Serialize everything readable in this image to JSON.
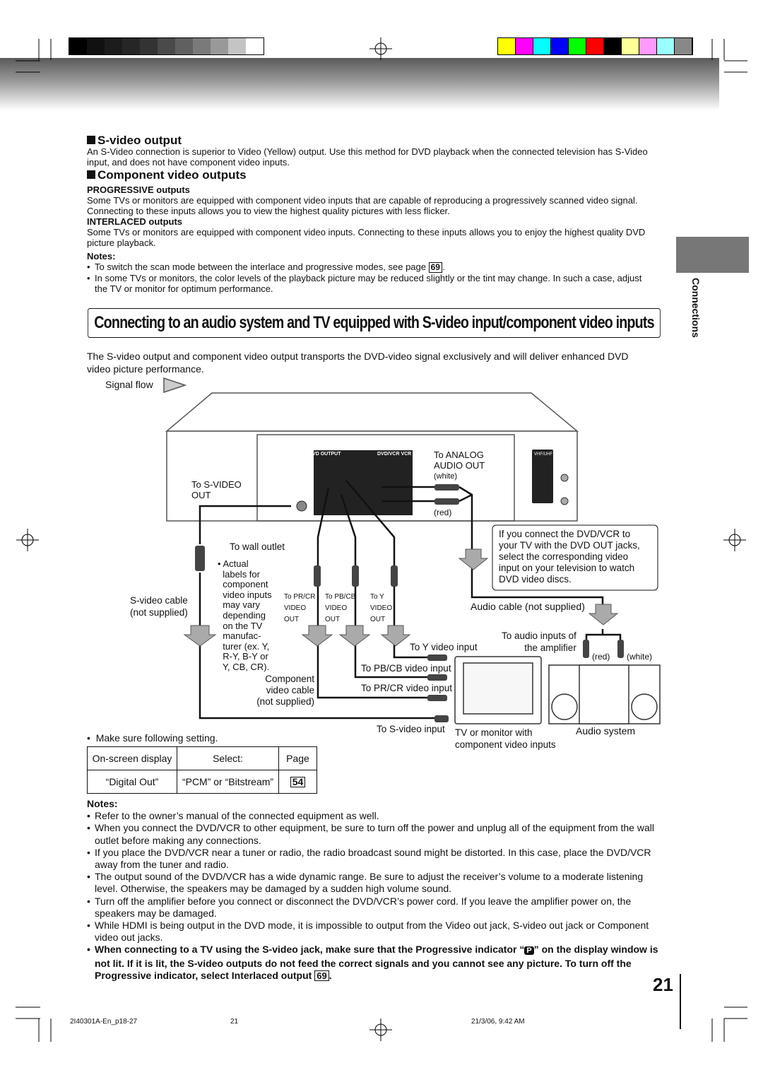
{
  "colors": {
    "gray_bars": [
      "#000",
      "#111",
      "#1c1c1c",
      "#262626",
      "#333",
      "#4a4a4a",
      "#606060",
      "#7a7a7a",
      "#999",
      "#c4c4c4",
      "#fff"
    ],
    "color_bars": [
      "#ffff00",
      "#ff00ff",
      "#00ffff",
      "#0000ff",
      "#00ff00",
      "#ff0000",
      "#000000",
      "#ffff99",
      "#ff99ff",
      "#99ffff",
      "#888888"
    ]
  },
  "side_tab": "Connections",
  "svideo": {
    "title": "S-video output",
    "text": "An S-Video connection is superior to Video (Yellow) output. Use this method for DVD playback when the connected television has S-Video input, and does not have component video inputs."
  },
  "component": {
    "title": "Component video outputs",
    "prog_title": "PROGRESSIVE outputs",
    "prog_text": "Some TVs or monitors are equipped with component video inputs that are capable of reproducing a progressively scanned video signal. Connecting to these inputs allows you to view the highest quality pictures with less flicker.",
    "inter_title": "INTERLACED outputs",
    "inter_text": "Some TVs or monitors are equipped with component video inputs. Connecting to these inputs allows you to enjoy the highest quality DVD picture playback."
  },
  "notes1": {
    "title": "Notes:",
    "items": [
      "To switch the scan mode between the interlace and progressive modes, see page",
      "In some TVs or monitors, the color levels of the playback picture may be reduced slightly or the tint may change. In such a case, adjust the TV or monitor for optimum performance."
    ],
    "page_ref": "69"
  },
  "banner": "Connecting to an audio system and TV equipped with S-video input/component video inputs",
  "intro": "The S-video output and component video output transports the DVD-video signal exclusively and will deliver enhanced DVD video picture performance.",
  "diagram": {
    "signal_flow": "Signal flow",
    "to_svideo_out": "To S-VIDEO\nOUT",
    "to_analog": "To ANALOG\nAUDIO OUT",
    "white": "(white)",
    "red": "(red)",
    "wall": "To wall outlet",
    "actual": "• Actual\n  labels for\n  component\n  video inputs\n  may vary\n  depending\n  on the TV\n  manufac-\n  turer (ex. Y,\n  R-Y, B-Y or\n  Y, CB, CR).",
    "pr_out": "To PR/CR\nVIDEO\nOUT",
    "pb_out": "To PB/CB\nVIDEO\nOUT",
    "y_out": "To Y\nVIDEO\nOUT",
    "svideo_cable": "S-video cable\n(not supplied)",
    "comp_cable": "Component\nvideo cable\n(not supplied)",
    "y_in": "To Y video input",
    "pb_in": "To PB/CB video input",
    "pr_in": "To PR/CR video input",
    "sv_in": "To S-video input",
    "note_box": "If you connect the DVD/VCR to\nyour TV with the DVD OUT jacks,\nselect the corresponding video\ninput on your television to watch\nDVD video discs.",
    "audio_cable": "Audio cable (not supplied)",
    "amp_in": "To audio inputs of\nthe amplifier",
    "red2": "(red)",
    "white2": "(white)",
    "tv": "TV or monitor with\ncomponent video inputs",
    "audio_sys": "Audio system",
    "panel_dvd": "DVD OUTPUT",
    "panel_vcr": "DVD/VCR VCR",
    "panel_vhf": "VHF/UHF"
  },
  "setting": {
    "intro": "Make sure following setting.",
    "headers": [
      "On-screen display",
      "Select:",
      "Page"
    ],
    "row": [
      "“Digital Out”",
      "“PCM” or “Bitstream”",
      "54"
    ]
  },
  "notes2": {
    "title": "Notes:",
    "items": [
      "Refer to the owner’s manual of the connected equipment as well.",
      "When you connect the DVD/VCR to other equipment, be sure to turn off the power and unplug all of the equipment from the wall outlet before making any connections.",
      "If you place the DVD/VCR near a tuner or radio, the radio broadcast sound might be distorted. In this case, place the DVD/VCR away from the tuner and radio.",
      "The output sound of the DVD/VCR has a wide dynamic range. Be sure to adjust the receiver’s volume to a moderate listening level. Otherwise, the speakers may be damaged by a sudden high volume sound.",
      "Turn off the amplifier before you connect or disconnect the DVD/VCR’s power cord. If you leave the amplifier power on, the speakers may be damaged.",
      "While HDMI is being output in the DVD mode, it is impossible to output from the Video out jack, S-video out jack or Component video out jacks."
    ],
    "bold_a": "When connecting to a TV using the S-video jack, make sure that the Progressive indicator “",
    "bold_icon": "P",
    "bold_b": "” on the display window is not lit. If it is lit, the S-video outputs do not feed the correct signals and you cannot see any picture. To turn off the Progressive indicator, select Interlaced output",
    "bold_page": "69"
  },
  "page_number": "21",
  "footer": {
    "file": "2I40301A-En_p18-27",
    "page": "21",
    "date": "21/3/06, 9:42 AM"
  }
}
